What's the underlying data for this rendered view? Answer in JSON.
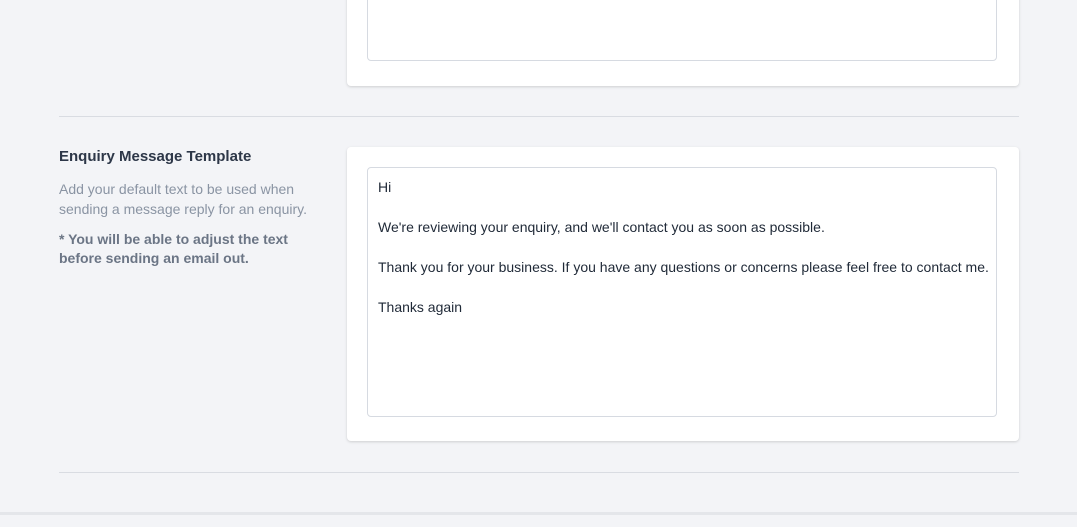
{
  "section": {
    "title": "Enquiry Message Template",
    "description": "Add your default text to be used when sending a message reply for an enquiry.",
    "note": "* You will be able to adjust the text before sending an email out."
  },
  "template": {
    "lines": [
      "Hi",
      "",
      "We're reviewing your enquiry, and we'll contact you as soon as possible.",
      "",
      "Thank you for your business. If you have any questions or concerns please feel free to contact me.",
      "",
      "Thanks again"
    ]
  }
}
